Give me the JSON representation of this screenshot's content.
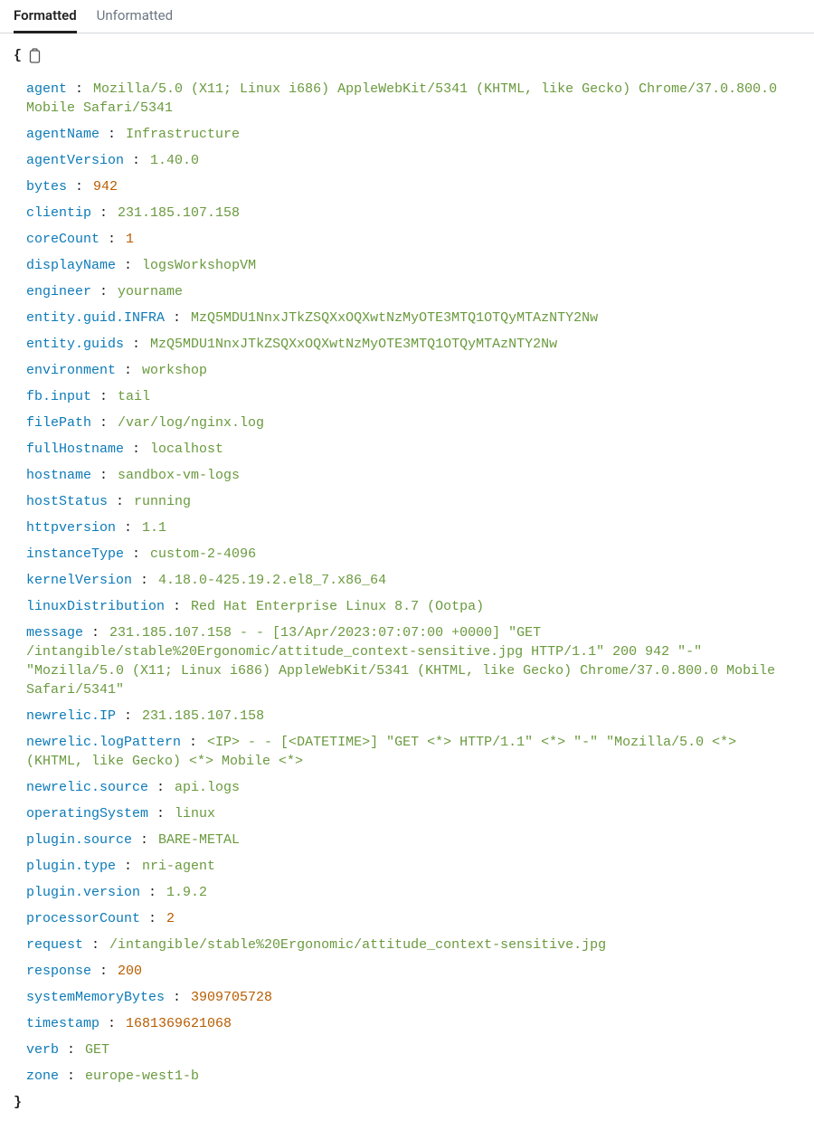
{
  "tabs": {
    "formatted": "Formatted",
    "unformatted": "Unformatted"
  },
  "rows": [
    {
      "key": "agent",
      "value": "Mozilla/5.0 (X11; Linux i686) AppleWebKit/5341 (KHTML, like Gecko) Chrome/37.0.800.0 Mobile Safari/5341",
      "type": "str"
    },
    {
      "key": "agentName",
      "value": "Infrastructure",
      "type": "str"
    },
    {
      "key": "agentVersion",
      "value": "1.40.0",
      "type": "str"
    },
    {
      "key": "bytes",
      "value": "942",
      "type": "num"
    },
    {
      "key": "clientip",
      "value": "231.185.107.158",
      "type": "str"
    },
    {
      "key": "coreCount",
      "value": "1",
      "type": "num"
    },
    {
      "key": "displayName",
      "value": "logsWorkshopVM",
      "type": "str"
    },
    {
      "key": "engineer",
      "value": "yourname",
      "type": "str"
    },
    {
      "key": "entity.guid.INFRA",
      "value": "MzQ5MDU1NnxJTkZSQXxOQXwtNzMyOTE3MTQ1OTQyMTAzNTY2Nw",
      "type": "str"
    },
    {
      "key": "entity.guids",
      "value": "MzQ5MDU1NnxJTkZSQXxOQXwtNzMyOTE3MTQ1OTQyMTAzNTY2Nw",
      "type": "str"
    },
    {
      "key": "environment",
      "value": "workshop",
      "type": "str"
    },
    {
      "key": "fb.input",
      "value": "tail",
      "type": "str"
    },
    {
      "key": "filePath",
      "value": "/var/log/nginx.log",
      "type": "str"
    },
    {
      "key": "fullHostname",
      "value": "localhost",
      "type": "str"
    },
    {
      "key": "hostname",
      "value": "sandbox-vm-logs",
      "type": "str"
    },
    {
      "key": "hostStatus",
      "value": "running",
      "type": "str"
    },
    {
      "key": "httpversion",
      "value": "1.1",
      "type": "str"
    },
    {
      "key": "instanceType",
      "value": "custom-2-4096",
      "type": "str"
    },
    {
      "key": "kernelVersion",
      "value": "4.18.0-425.19.2.el8_7.x86_64",
      "type": "str"
    },
    {
      "key": "linuxDistribution",
      "value": "Red Hat Enterprise Linux 8.7 (Ootpa)",
      "type": "str"
    },
    {
      "key": "message",
      "value": "231.185.107.158 - - [13/Apr/2023:07:07:00 +0000] \"GET /intangible/stable%20Ergonomic/attitude_context-sensitive.jpg HTTP/1.1\" 200 942 \"-\" \"Mozilla/5.0 (X11; Linux i686) AppleWebKit/5341 (KHTML, like Gecko) Chrome/37.0.800.0 Mobile Safari/5341\"",
      "type": "str"
    },
    {
      "key": "newrelic.IP",
      "value": "231.185.107.158",
      "type": "str"
    },
    {
      "key": "newrelic.logPattern",
      "value": "<IP> - - [<DATETIME>] \"GET <*> HTTP/1.1\" <*> \"-\" \"Mozilla/5.0 <*> (KHTML, like Gecko) <*> Mobile <*>",
      "type": "str"
    },
    {
      "key": "newrelic.source",
      "value": "api.logs",
      "type": "str"
    },
    {
      "key": "operatingSystem",
      "value": "linux",
      "type": "str"
    },
    {
      "key": "plugin.source",
      "value": "BARE-METAL",
      "type": "str"
    },
    {
      "key": "plugin.type",
      "value": "nri-agent",
      "type": "str"
    },
    {
      "key": "plugin.version",
      "value": "1.9.2",
      "type": "str"
    },
    {
      "key": "processorCount",
      "value": "2",
      "type": "num"
    },
    {
      "key": "request",
      "value": "/intangible/stable%20Ergonomic/attitude_context-sensitive.jpg",
      "type": "str"
    },
    {
      "key": "response",
      "value": "200",
      "type": "num"
    },
    {
      "key": "systemMemoryBytes",
      "value": "3909705728",
      "type": "num"
    },
    {
      "key": "timestamp",
      "value": "1681369621068",
      "type": "num"
    },
    {
      "key": "verb",
      "value": "GET",
      "type": "str"
    },
    {
      "key": "zone",
      "value": "europe-west1-b",
      "type": "str"
    }
  ],
  "braces": {
    "open": "{",
    "close": "}"
  },
  "colon": ":"
}
